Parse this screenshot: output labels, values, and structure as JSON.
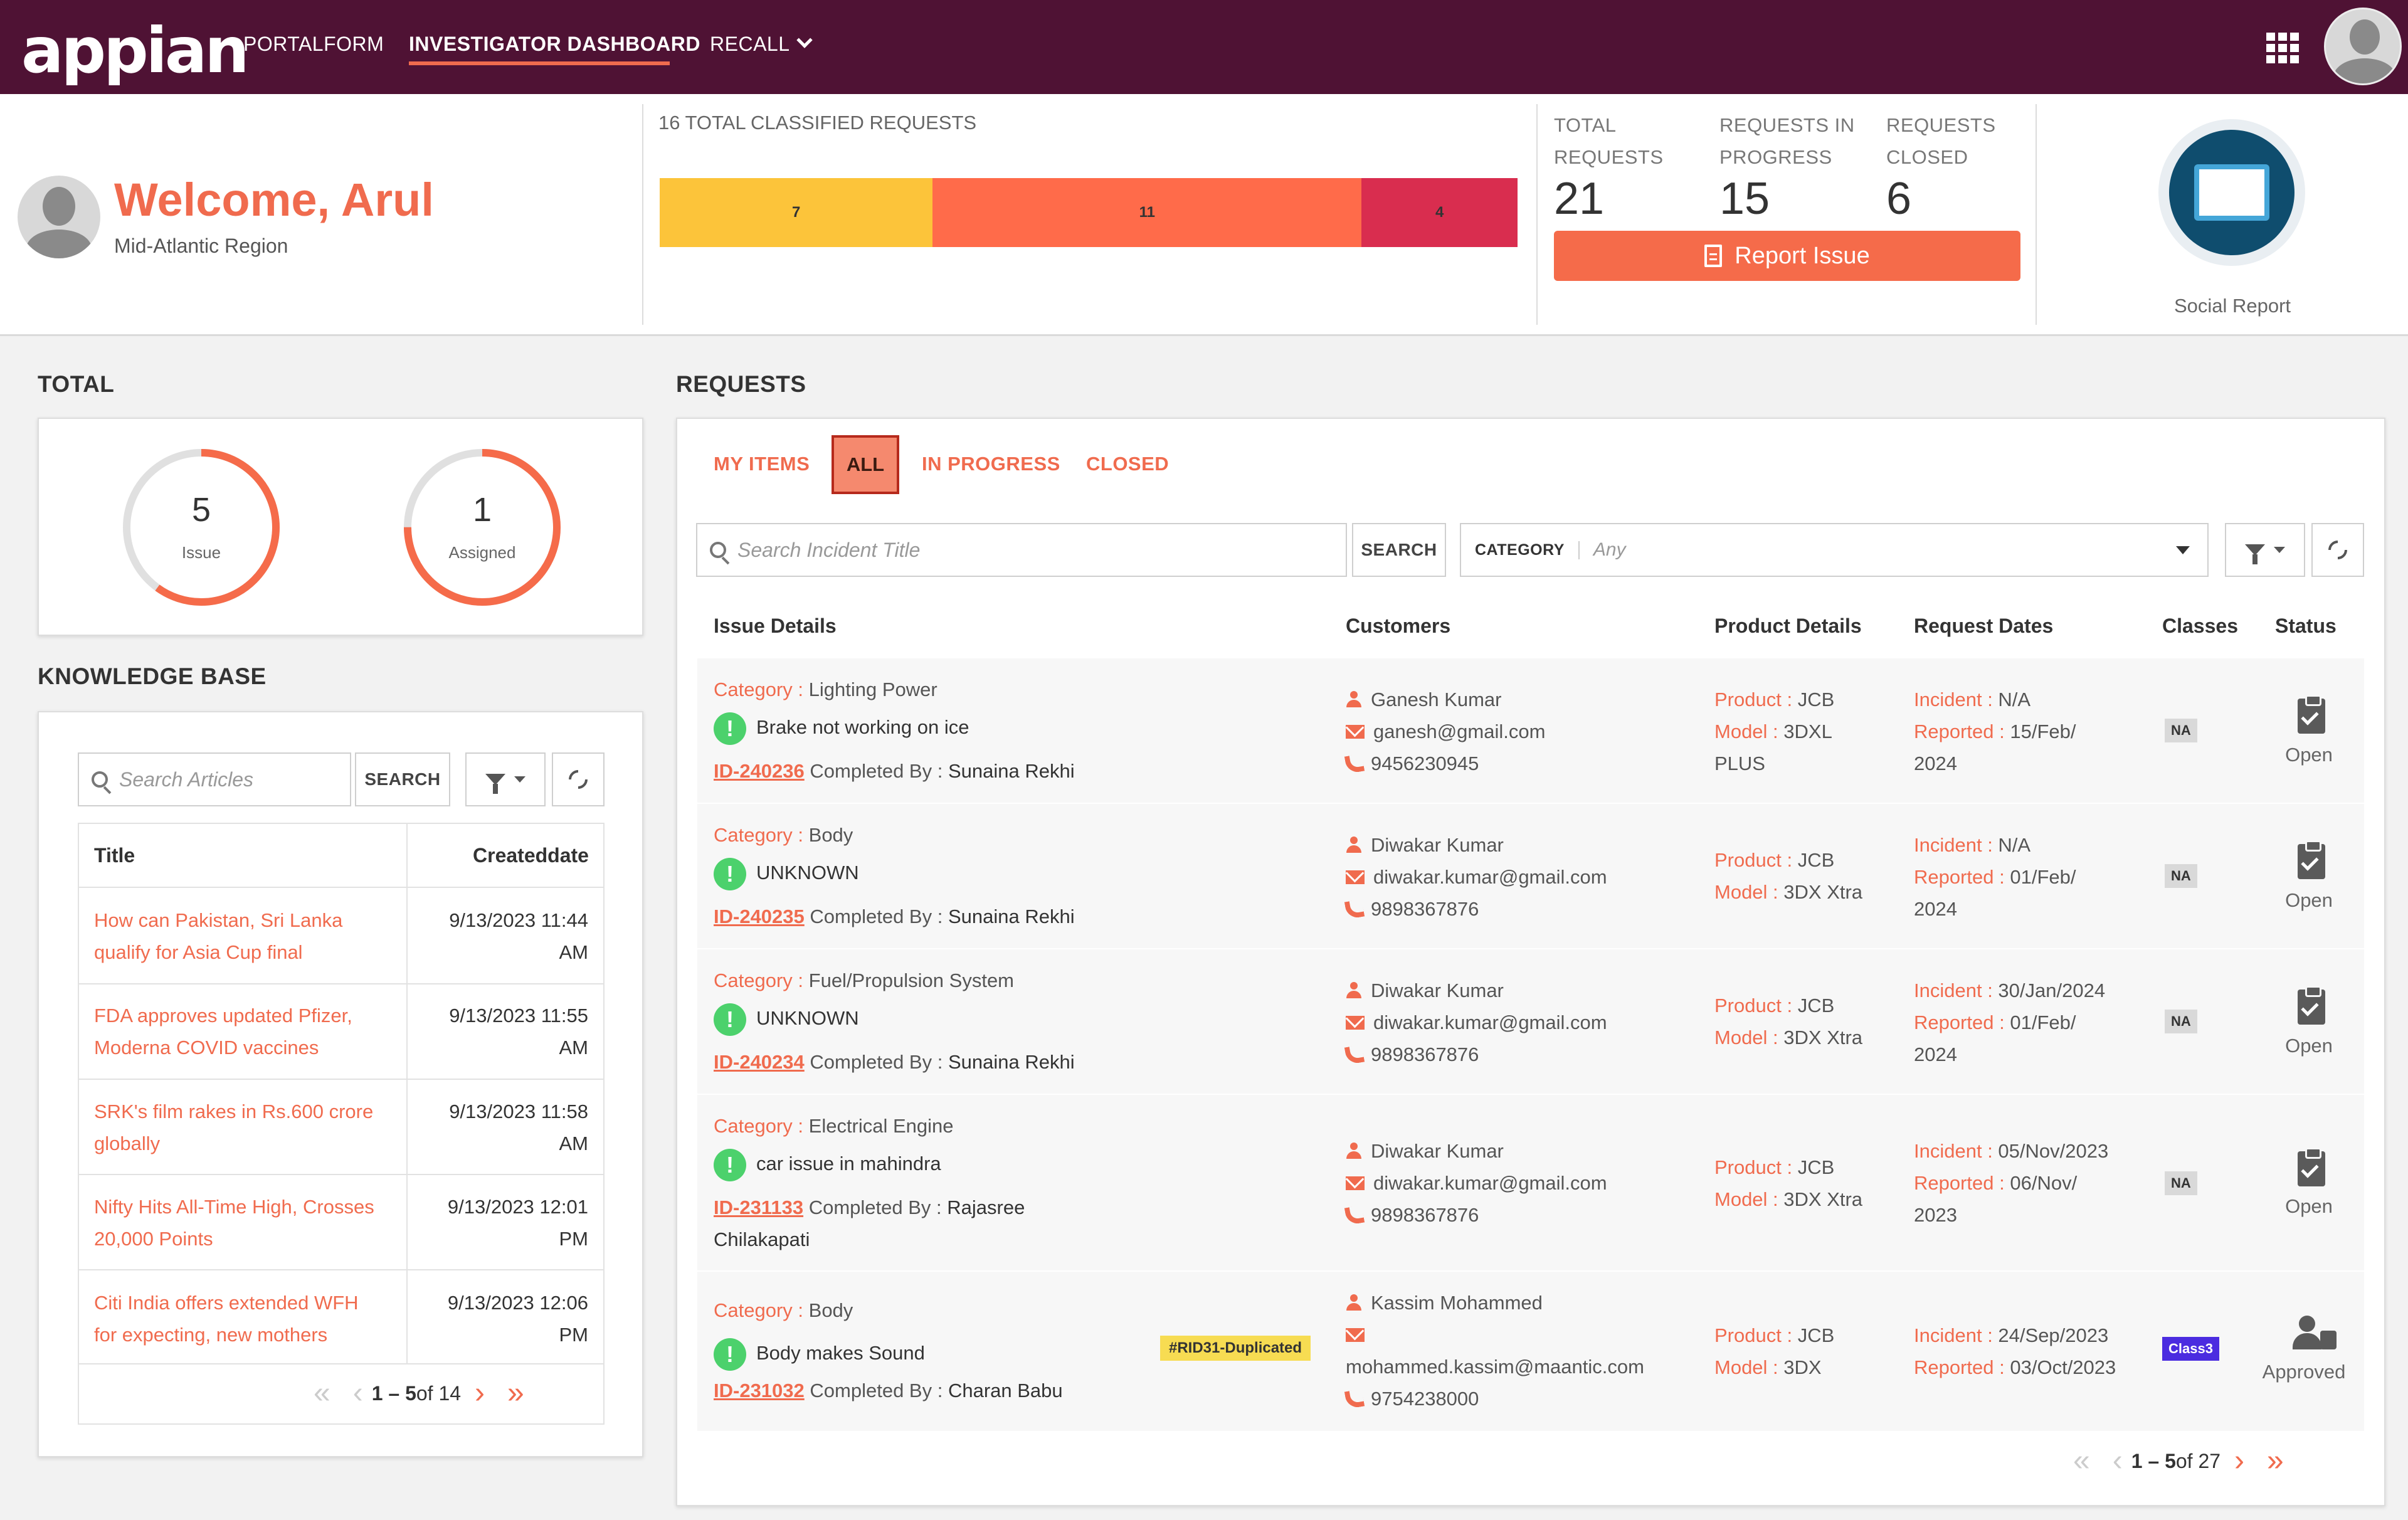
{
  "nav": {
    "logo": "appian",
    "links": [
      "PORTALFORM",
      "INVESTIGATOR DASHBOARD",
      "RECALL"
    ]
  },
  "header": {
    "welcome": "Welcome, Arul",
    "region": "Mid-Atlantic Region",
    "total_classified": "16  TOTAL CLASSIFIED REQUESTS",
    "segments": [
      {
        "value": 7,
        "label": "7",
        "color": "#fcc43a"
      },
      {
        "value": 11,
        "label": "11",
        "color": "#ff6b4a"
      },
      {
        "value": 4,
        "label": "4",
        "color": "#d92d4f"
      }
    ],
    "stats": [
      {
        "label_line1": "TOTAL",
        "label_line2": "REQUESTS",
        "value": "21"
      },
      {
        "label_line1": "REQUESTS IN",
        "label_line2": "PROGRESS",
        "value": "15"
      },
      {
        "label_line1": "REQUESTS",
        "label_line2": "CLOSED",
        "value": "6"
      }
    ],
    "report_button": "Report Issue",
    "social_label": "Social Report"
  },
  "total": {
    "title": "TOTAL",
    "donuts": [
      {
        "value": "5",
        "label": "Issue",
        "fill": 0.6
      },
      {
        "value": "1",
        "label": "Assigned",
        "fill": 0.75
      }
    ]
  },
  "knowledge_base": {
    "title": "KNOWLEDGE BASE",
    "search_placeholder": "Search Articles",
    "search_button": "SEARCH",
    "col_title": "Title",
    "col_date": "Createddate",
    "rows": [
      {
        "title_l1": "How can Pakistan, Sri Lanka",
        "title_l2": "qualify for Asia Cup final",
        "date_l1": "9/13/2023 11:44",
        "date_l2": "AM"
      },
      {
        "title_l1": "FDA approves updated Pfizer,",
        "title_l2": "Moderna COVID vaccines",
        "date_l1": "9/13/2023 11:55",
        "date_l2": "AM"
      },
      {
        "title_l1": "SRK's film rakes in Rs.600 crore",
        "title_l2": "globally",
        "date_l1": "9/13/2023 11:58",
        "date_l2": "AM"
      },
      {
        "title_l1": "Nifty Hits All-Time High, Crosses",
        "title_l2": "20,000 Points",
        "date_l1": "9/13/2023 12:01",
        "date_l2": "PM"
      },
      {
        "title_l1": "Citi India offers extended WFH",
        "title_l2": "for expecting, new mothers",
        "date_l1": "9/13/2023 12:06",
        "date_l2": "PM"
      }
    ],
    "pager_range": "1 – 5",
    "pager_total": " of 14"
  },
  "requests": {
    "title": "REQUESTS",
    "tabs": [
      "MY ITEMS",
      "ALL",
      "IN PROGRESS",
      "CLOSED"
    ],
    "search_placeholder": "Search Incident Title",
    "search_button": "SEARCH",
    "category_label": "CATEGORY",
    "category_value": "Any",
    "columns": [
      "Issue Details",
      "Customers",
      "Product Details",
      "Request Dates",
      "Classes",
      "Status"
    ],
    "labels": {
      "category": "Category",
      "completed_by": "Completed By",
      "product": "Product",
      "model": "Model",
      "incident": "Incident",
      "reported": "Reported"
    },
    "rows": [
      {
        "category": "Lighting Power",
        "issue": "Brake not working on ice",
        "id": "ID-240236",
        "completed_by": "Sunaina Rekhi",
        "customer": "Ganesh Kumar",
        "email": "ganesh@gmail.com",
        "phone": "9456230945",
        "product": "JCB",
        "model": "3DXL",
        "model_l2": "PLUS",
        "incident": "N/A",
        "reported": "15/Feb/",
        "reported_l2": "2024",
        "class": "NA",
        "status": "Open"
      },
      {
        "category": "Body",
        "issue": "UNKNOWN",
        "id": "ID-240235",
        "completed_by": "Sunaina Rekhi",
        "customer": "Diwakar Kumar",
        "email": "diwakar.kumar@gmail.com",
        "phone": "9898367876",
        "product": "JCB",
        "model": "3DX Xtra",
        "incident": "N/A",
        "reported": "01/Feb/",
        "reported_l2": "2024",
        "class": "NA",
        "status": "Open"
      },
      {
        "category": "Fuel/Propulsion System",
        "issue": "UNKNOWN",
        "id": "ID-240234",
        "completed_by": "Sunaina Rekhi",
        "customer": "Diwakar Kumar",
        "email": "diwakar.kumar@gmail.com",
        "phone": "9898367876",
        "product": "JCB",
        "model": "3DX Xtra",
        "incident": "30/Jan/2024",
        "reported": "01/Feb/",
        "reported_l2": "2024",
        "class": "NA",
        "status": "Open"
      },
      {
        "category": "Electrical Engine",
        "issue": "car issue in mahindra",
        "id": "ID-231133",
        "completed_by": "Rajasree",
        "completed_by_l2": "Chilakapati",
        "customer": "Diwakar Kumar",
        "email": "diwakar.kumar@gmail.com",
        "phone": "9898367876",
        "product": "JCB",
        "model": "3DX Xtra",
        "incident": "05/Nov/2023",
        "reported": "06/Nov/",
        "reported_l2": "2023",
        "class": "NA",
        "status": "Open"
      },
      {
        "category": "Body",
        "issue": "Body makes Sound",
        "tag": "#RID31-Duplicated",
        "id": "ID-231032",
        "completed_by": "Charan Babu",
        "customer": "Kassim Mohammed",
        "email": "mohammed.kassim@maantic.com",
        "phone": "9754238000",
        "product": "JCB",
        "model": "3DX",
        "incident": "24/Sep/2023",
        "reported": "03/Oct/2023",
        "class": "Class3",
        "status": "Approved"
      }
    ],
    "pager_range": "1 – 5",
    "pager_total": " of 27"
  }
}
